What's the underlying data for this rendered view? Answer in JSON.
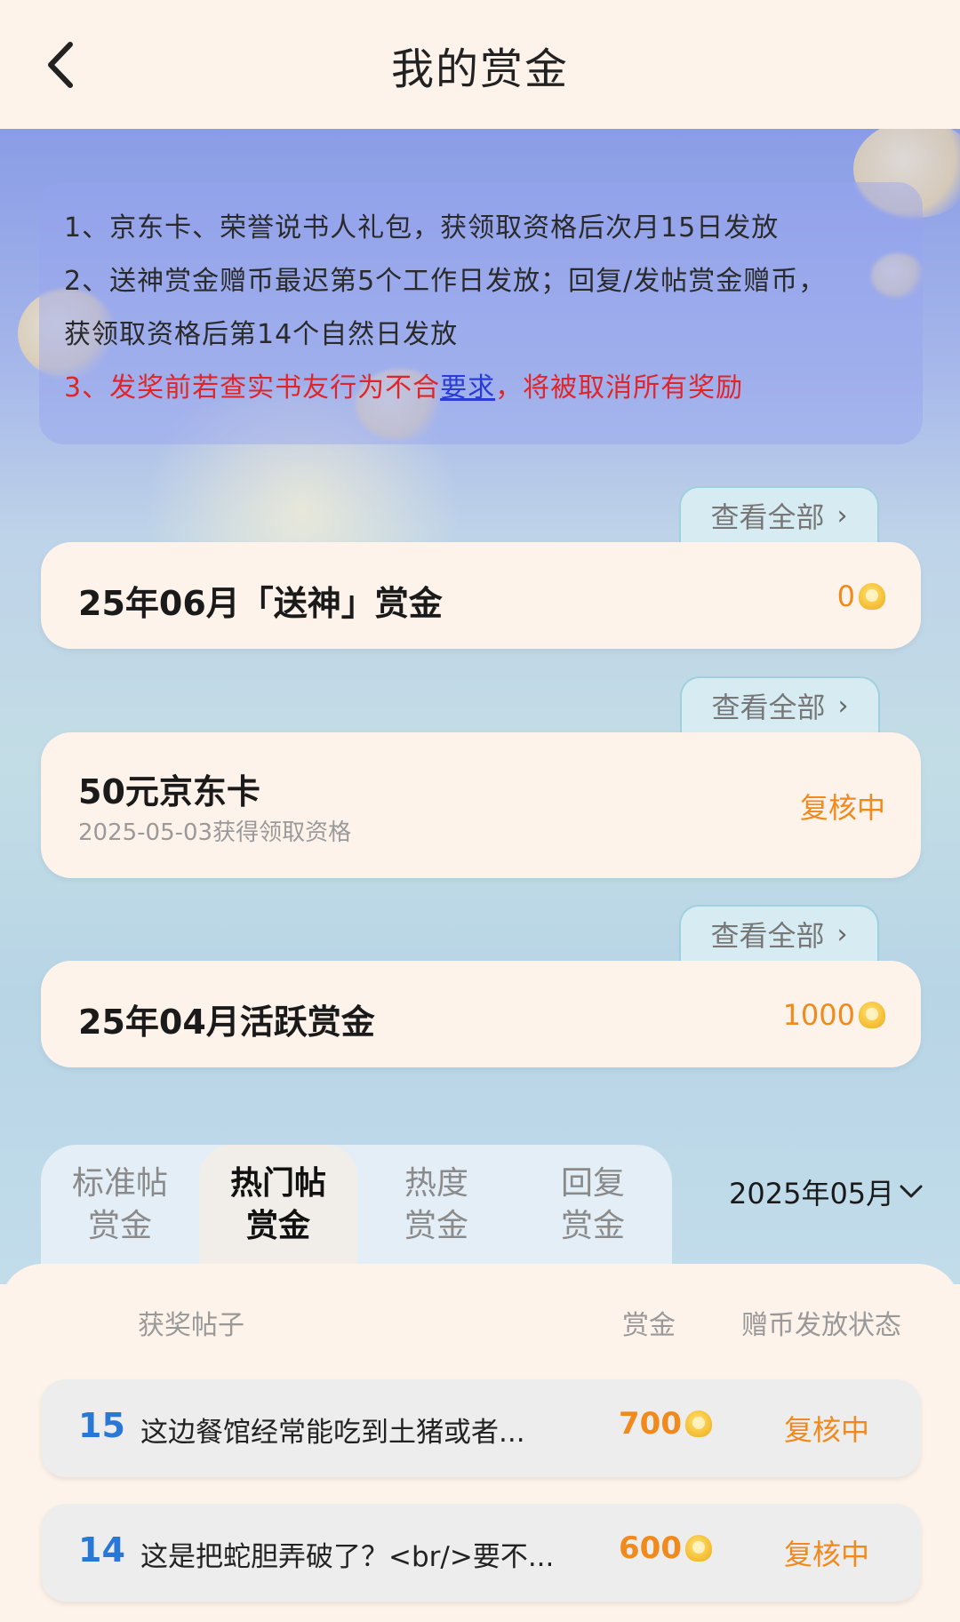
{
  "header": {
    "title": "我的赏金"
  },
  "notice": {
    "line1": "1、京东卡、荣誉说书人礼包，获领取资格后次月15日发放",
    "line2": "2、送神赏金赠币最迟第5个工作日发放；回复/发帖赏金赠币，",
    "line3": "获领取资格后第14个自然日发放",
    "line4_prefix": "3、发奖前若查实书友行为不合",
    "line4_link": "要求",
    "line4_suffix": "，将被取消所有奖励"
  },
  "view_all_label": "查看全部",
  "cards": [
    {
      "title": "25年06月「送神」赏金",
      "value": "0",
      "icon": "coin-icon"
    },
    {
      "title": "50元京东卡",
      "subtitle": "2025-05-03获得领取资格",
      "status": "复核中"
    },
    {
      "title": "25年04月活跃赏金",
      "value": "1000",
      "icon": "coin-icon"
    }
  ],
  "tabs": [
    {
      "line1": "标准帖",
      "line2": "赏金",
      "active": false
    },
    {
      "line1": "热门帖",
      "line2": "赏金",
      "active": true
    },
    {
      "line1": "热度",
      "line2": "赏金",
      "active": false
    },
    {
      "line1": "回复",
      "line2": "赏金",
      "active": false
    }
  ],
  "month_select": {
    "value": "2025年05月"
  },
  "table": {
    "headers": [
      "获奖帖子",
      "赏金",
      "赠币发放状态"
    ],
    "rows": [
      {
        "rank": "15",
        "title": "这边餐馆经常能吃到土猪或者...",
        "amount": "700",
        "status": "复核中"
      },
      {
        "rank": "14",
        "title": "这是把蛇胆弄破了？<br/>要不...",
        "amount": "600",
        "status": "复核中"
      }
    ]
  },
  "colors": {
    "accent": "#f08a1c",
    "rank": "#2a78d6",
    "warning": "#e0252a"
  }
}
